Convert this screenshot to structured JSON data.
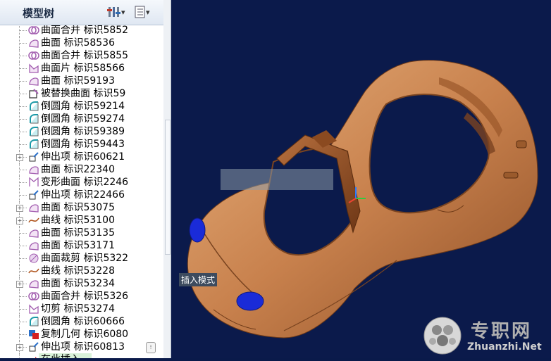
{
  "panel": {
    "title": "模型树"
  },
  "tree_items": [
    {
      "label": "曲面合并 标识5852",
      "icon": "merge-icon",
      "expander": false
    },
    {
      "label": "曲面 标识58536",
      "icon": "surface-icon",
      "expander": false
    },
    {
      "label": "曲面合并 标识5855",
      "icon": "merge-icon",
      "expander": false
    },
    {
      "label": "曲面片 标识58566",
      "icon": "surface-patch-icon",
      "expander": false
    },
    {
      "label": "曲面 标识59193",
      "icon": "surface-icon",
      "expander": false
    },
    {
      "label": "被替换曲面 标识59",
      "icon": "replaced-surface-icon",
      "expander": false
    },
    {
      "label": "倒圆角 标识59214",
      "icon": "round-icon",
      "expander": false
    },
    {
      "label": "倒圆角 标识59274",
      "icon": "round-icon",
      "expander": false
    },
    {
      "label": "倒圆角 标识59389",
      "icon": "round-icon",
      "expander": false
    },
    {
      "label": "倒圆角 标识59443",
      "icon": "round-icon",
      "expander": false
    },
    {
      "label": "伸出项 标识60621",
      "icon": "extrude-icon",
      "expander": true
    },
    {
      "label": "曲面 标识22340",
      "icon": "surface-icon",
      "expander": false
    },
    {
      "label": "变形曲面 标识2246",
      "icon": "warp-surface-icon",
      "expander": false
    },
    {
      "label": "伸出项 标识22466",
      "icon": "extrude-icon",
      "expander": false
    },
    {
      "label": "曲面 标识53075",
      "icon": "surface-icon",
      "expander": true
    },
    {
      "label": "曲线 标识53100",
      "icon": "curve-icon",
      "expander": true
    },
    {
      "label": "曲面 标识53135",
      "icon": "surface-icon",
      "expander": false
    },
    {
      "label": "曲面 标识53171",
      "icon": "surface-icon",
      "expander": false
    },
    {
      "label": "曲面裁剪 标识5322",
      "icon": "surface-trim-icon",
      "expander": false
    },
    {
      "label": "曲线 标识53228",
      "icon": "curve-icon",
      "expander": false
    },
    {
      "label": "曲面 标识53234",
      "icon": "surface-icon",
      "expander": true
    },
    {
      "label": "曲面合并 标识5326",
      "icon": "merge-icon",
      "expander": false
    },
    {
      "label": "切剪 标识53274",
      "icon": "cut-icon",
      "expander": false
    },
    {
      "label": "倒圆角 标识60666",
      "icon": "round-icon",
      "expander": false
    },
    {
      "label": "复制几何 标识6080",
      "icon": "copy-geometry-icon",
      "expander": false
    },
    {
      "label": "伸出项 标识60813",
      "icon": "extrude-icon",
      "expander": true
    },
    {
      "label": "在此插入",
      "icon": "insert-here-arrow-icon",
      "expander": false
    }
  ],
  "viewport": {
    "mode_label": "插入模式"
  },
  "watermark": {
    "cn": "专职网",
    "en": "Zhuanzhi.Net"
  },
  "colors": {
    "car_body": "#c8814d",
    "headlight": "#1a2bd8",
    "background": "#0b1a4b"
  }
}
